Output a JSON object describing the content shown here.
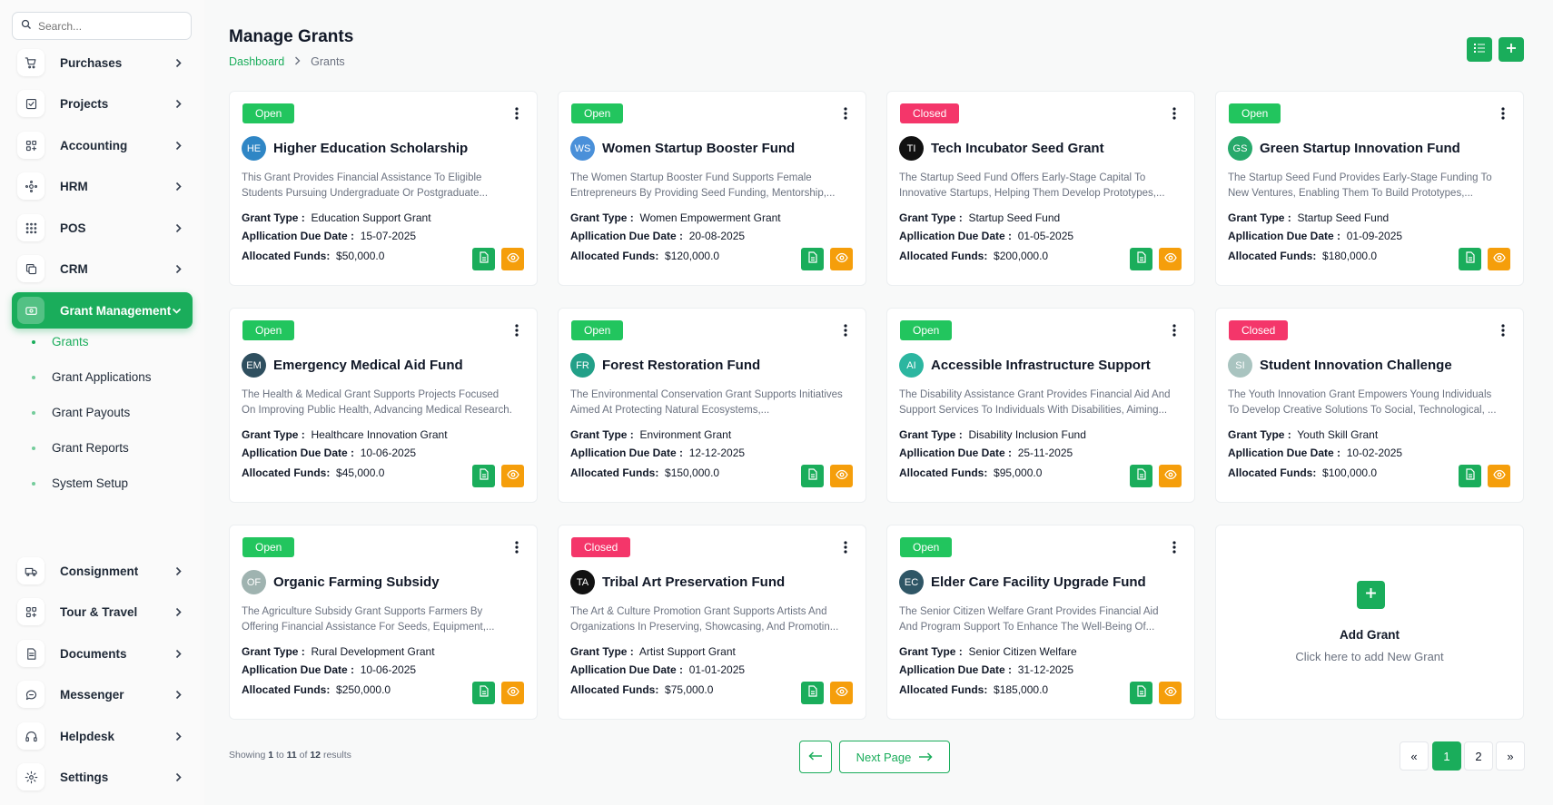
{
  "search": {
    "placeholder": "Search..."
  },
  "sidebar": {
    "items_top": [
      {
        "label": "Purchases",
        "icon": "cart-icon"
      },
      {
        "label": "Projects",
        "icon": "checkbox-icon"
      },
      {
        "label": "Accounting",
        "icon": "grid-icon"
      },
      {
        "label": "HRM",
        "icon": "people-icon"
      },
      {
        "label": "POS",
        "icon": "dots-grid-icon"
      },
      {
        "label": "CRM",
        "icon": "copy-icon"
      }
    ],
    "active": {
      "label": "Grant Management",
      "icon": "money-icon"
    },
    "subitems": [
      {
        "label": "Grants"
      },
      {
        "label": "Grant Applications"
      },
      {
        "label": "Grant Payouts"
      },
      {
        "label": "Grant Reports"
      },
      {
        "label": "System Setup"
      }
    ],
    "items_bottom": [
      {
        "label": "Consignment",
        "icon": "truck-icon"
      },
      {
        "label": "Tour & Travel",
        "icon": "grid-icon"
      },
      {
        "label": "Documents",
        "icon": "document-icon"
      },
      {
        "label": "Messenger",
        "icon": "chat-icon"
      },
      {
        "label": "Helpdesk",
        "icon": "headset-icon"
      },
      {
        "label": "Settings",
        "icon": "gear-icon"
      }
    ]
  },
  "header": {
    "title": "Manage Grants",
    "breadcrumb": {
      "home": "Dashboard",
      "current": "Grants"
    }
  },
  "labels": {
    "grant_type": "Grant Type :",
    "due_date": "Apllication Due Date :",
    "funds": "Allocated Funds:"
  },
  "grants": [
    {
      "status": "Open",
      "initials": "HE",
      "avatar_color": "#2f86c5",
      "title": "Higher Education Scholarship",
      "desc": "This Grant Provides Financial Assistance To Eligible Students Pursuing Undergraduate Or Postgraduate...",
      "type": "Education Support Grant",
      "due": "15-07-2025",
      "funds": "$50,000.0"
    },
    {
      "status": "Open",
      "initials": "WS",
      "avatar_color": "#4a90d9",
      "title": "Women Startup Booster Fund",
      "desc": "The Women Startup Booster Fund Supports Female Entrepreneurs By Providing Seed Funding, Mentorship,...",
      "type": "Women Empowerment Grant",
      "due": "20-08-2025",
      "funds": "$120,000.0"
    },
    {
      "status": "Closed",
      "initials": "TI",
      "avatar_color": "#111111",
      "title": "Tech Incubator Seed Grant",
      "desc": "The Startup Seed Fund Offers Early-Stage Capital To Innovative Startups, Helping Them Develop Prototypes,...",
      "type": "Startup Seed Fund",
      "due": "01-05-2025",
      "funds": "$200,000.0"
    },
    {
      "status": "Open",
      "initials": "GS",
      "avatar_color": "#27a96b",
      "title": "Green Startup Innovation Fund",
      "desc": "The Startup Seed Fund Provides Early-Stage Funding To New Ventures, Enabling Them To Build Prototypes,...",
      "type": "Startup Seed Fund",
      "due": "01-09-2025",
      "funds": "$180,000.0"
    },
    {
      "status": "Open",
      "initials": "EM",
      "avatar_color": "#2f4f5f",
      "title": "Emergency Medical Aid Fund",
      "desc": "The Health & Medical Grant Supports Projects Focused On Improving Public Health, Advancing Medical Research.",
      "type": "Healthcare Innovation Grant",
      "due": "10-06-2025",
      "funds": "$45,000.0"
    },
    {
      "status": "Open",
      "initials": "FR",
      "avatar_color": "#22a088",
      "title": "Forest Restoration Fund",
      "desc": "The Environmental Conservation Grant Supports Initiatives Aimed At Protecting Natural Ecosystems,...",
      "type": "Environment Grant",
      "due": "12-12-2025",
      "funds": "$150,000.0"
    },
    {
      "status": "Open",
      "initials": "AI",
      "avatar_color": "#2cb6a0",
      "title": "Accessible Infrastructure Support",
      "desc": "The Disability Assistance Grant Provides Financial Aid And Support Services To Individuals With Disabilities, Aiming...",
      "type": "Disability Inclusion Fund",
      "due": "25-11-2025",
      "funds": "$95,000.0"
    },
    {
      "status": "Closed",
      "initials": "SI",
      "avatar_color": "#a9c4c0",
      "title": "Student Innovation Challenge",
      "desc": "The Youth Innovation Grant Empowers Young Individuals To Develop Creative Solutions To Social, Technological, ...",
      "type": "Youth Skill Grant",
      "due": "10-02-2025",
      "funds": "$100,000.0"
    },
    {
      "status": "Open",
      "initials": "OF",
      "avatar_color": "#9fb3b0",
      "title": "Organic Farming Subsidy",
      "desc": "The Agriculture Subsidy Grant Supports Farmers By Offering Financial Assistance For Seeds, Equipment,...",
      "type": "Rural Development Grant",
      "due": "10-06-2025",
      "funds": "$250,000.0"
    },
    {
      "status": "Closed",
      "initials": "TA",
      "avatar_color": "#111111",
      "title": "Tribal Art Preservation Fund",
      "desc": "The Art & Culture Promotion Grant Supports Artists And Organizations In Preserving, Showcasing, And Promotin...",
      "type": "Artist Support Grant",
      "due": "01-01-2025",
      "funds": "$75,000.0"
    },
    {
      "status": "Open",
      "initials": "EC",
      "avatar_color": "#2f5666",
      "title": "Elder Care Facility Upgrade Fund",
      "desc": "The Senior Citizen Welfare Grant Provides Financial Aid And Program Support To Enhance The Well-Being Of...",
      "type": "Senior Citizen Welfare",
      "due": "31-12-2025",
      "funds": "$185,000.0"
    }
  ],
  "add_card": {
    "title": "Add Grant",
    "subtitle": "Click here to add New Grant"
  },
  "footer": {
    "showing_prefix": "Showing ",
    "showing_from": "1",
    "showing_to_word": " to ",
    "showing_to": "11",
    "showing_of_word": " of ",
    "showing_total": "12",
    "showing_suffix": " results",
    "next_label": "Next Page",
    "pages": [
      "«",
      "1",
      "2",
      "»"
    ],
    "current_page": "1"
  },
  "colors": {
    "accent": "#1aad5b",
    "open": "#22c55e",
    "closed": "#f4366a",
    "view": "#f59e0b"
  }
}
